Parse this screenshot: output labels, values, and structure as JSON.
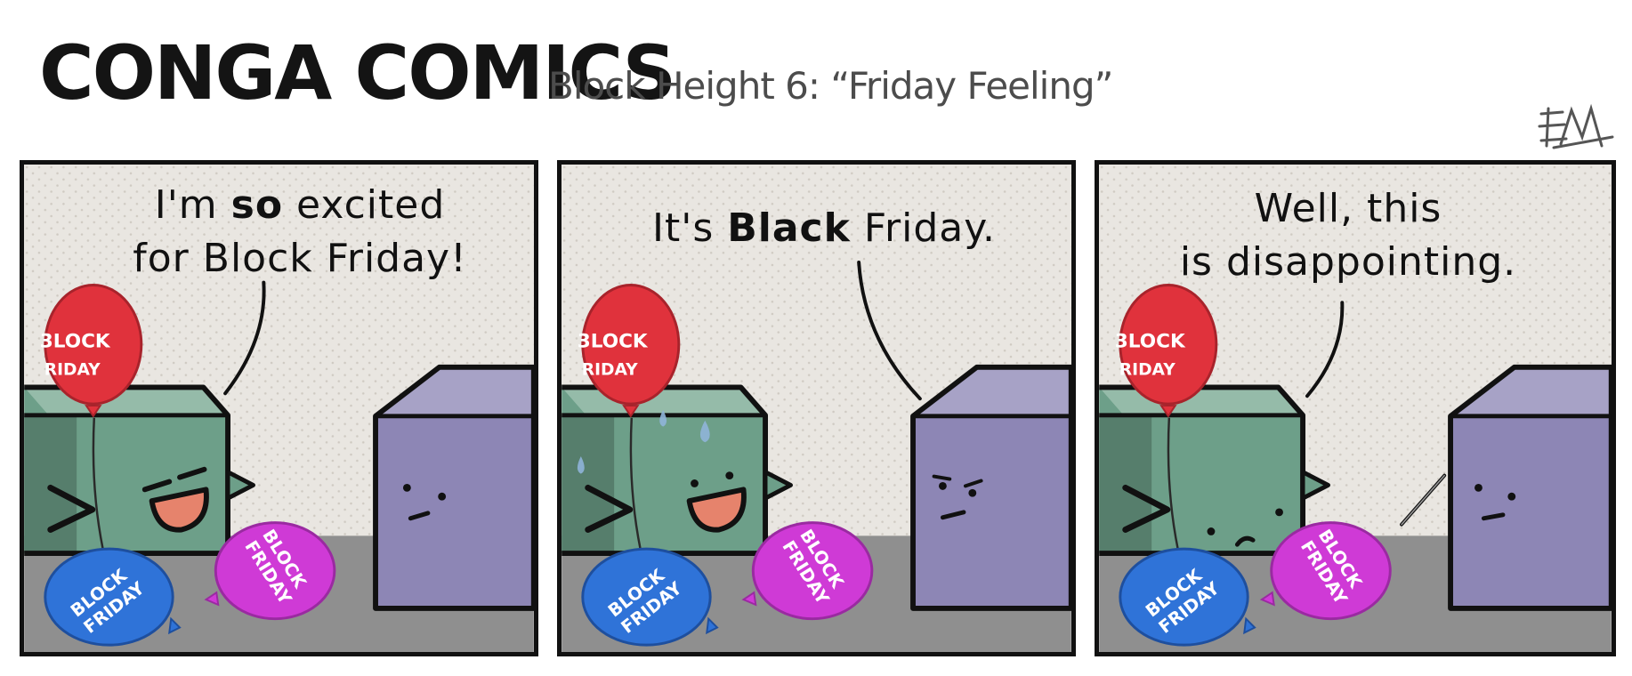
{
  "comic": {
    "title": "CONGA COMICS",
    "subtitle": "Block Height 6: “Friday Feeling”",
    "signature": "EM",
    "balloon_text_line1": "BLOCK",
    "balloon_text_line2": "FRIDAY",
    "balloon_text_partial_line1": "3LOCK",
    "balloon_text_partial_line2": "RIDAY",
    "colors": {
      "panel_bg": "#e9e6e1",
      "floor": "#8f8f8f",
      "green_block": "#6d9f89",
      "purple_block": "#8d86b5",
      "red_balloon": "#e0323c",
      "blue_balloon": "#2f73d8",
      "magenta_balloon": "#cf3ad6"
    }
  },
  "panels": [
    {
      "speech_line1_pre": "I'm ",
      "speech_line1_bold": "so",
      "speech_line1_post": " excited",
      "speech_line2": "for Block Friday!"
    },
    {
      "speech_pre": "It's ",
      "speech_bold": "Black",
      "speech_post": " Friday."
    },
    {
      "speech_line1": "Well, this",
      "speech_line2": "is disappointing."
    }
  ]
}
